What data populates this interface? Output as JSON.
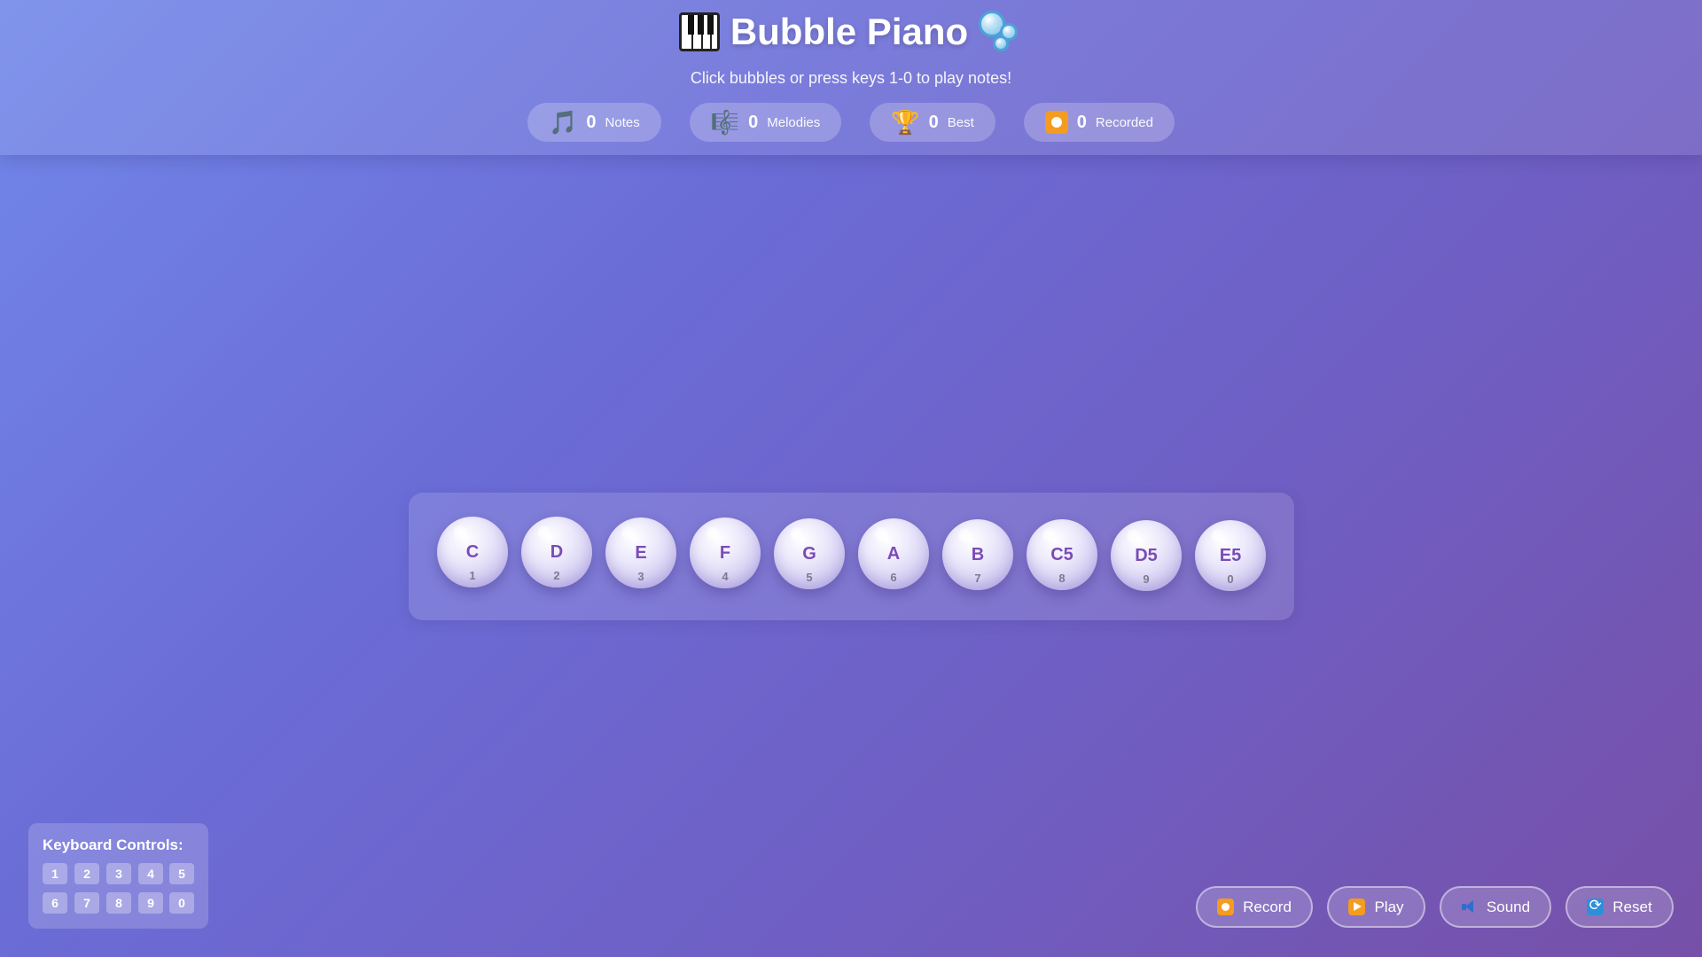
{
  "header": {
    "title": "Bubble Piano",
    "title_left_icon": "piano-icon",
    "title_right_icon": "bubbles-icon",
    "subtitle": "Click bubbles or press keys 1-0 to play notes!"
  },
  "stats": [
    {
      "icon": "🎵",
      "icon_name": "musical-note-icon",
      "value": "0",
      "label": "Notes"
    },
    {
      "icon": "🎼",
      "icon_name": "musical-score-icon",
      "value": "0",
      "label": "Melodies"
    },
    {
      "icon": "🏆",
      "icon_name": "trophy-icon",
      "value": "0",
      "label": "Best"
    },
    {
      "icon": "",
      "icon_name": "record-icon",
      "value": "0",
      "label": "Recorded"
    }
  ],
  "bubbles": [
    {
      "note": "C",
      "key": "1"
    },
    {
      "note": "D",
      "key": "2"
    },
    {
      "note": "E",
      "key": "3"
    },
    {
      "note": "F",
      "key": "4"
    },
    {
      "note": "G",
      "key": "5"
    },
    {
      "note": "A",
      "key": "6"
    },
    {
      "note": "B",
      "key": "7"
    },
    {
      "note": "C5",
      "key": "8"
    },
    {
      "note": "D5",
      "key": "9"
    },
    {
      "note": "E5",
      "key": "0"
    }
  ],
  "keyboard": {
    "title": "Keyboard Controls:",
    "keys": [
      "1",
      "2",
      "3",
      "4",
      "5",
      "6",
      "7",
      "8",
      "9",
      "0"
    ]
  },
  "controls": {
    "record_label": "Record",
    "play_label": "Play",
    "sound_label": "Sound",
    "reset_label": "Reset"
  },
  "colors": {
    "accent_note_text": "#7a4cb6",
    "icon_orange": "#f39c20",
    "icon_blue": "#2d6fd0"
  }
}
